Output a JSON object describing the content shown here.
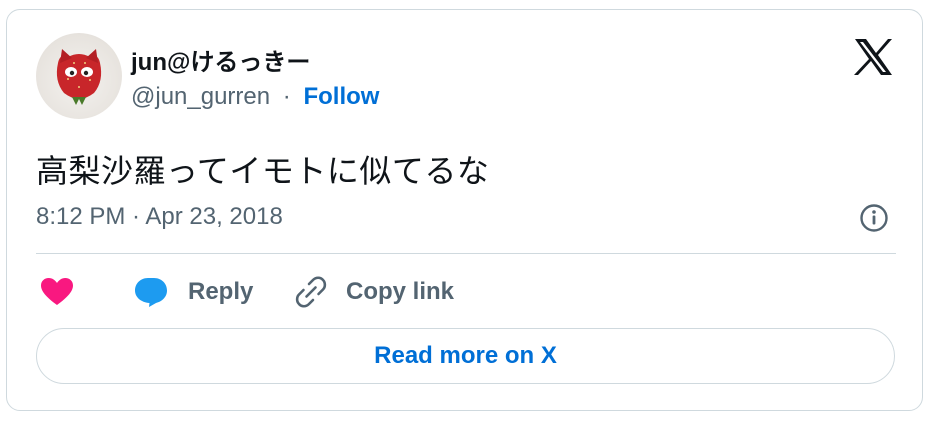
{
  "author": {
    "name": "jun@けるっきー",
    "handle": "@jun_gurren",
    "separator": "·",
    "follow_label": "Follow",
    "avatar_icon": "strawberry-cat-avatar-icon"
  },
  "tweet": {
    "text": "高梨沙羅ってイモトに似てるな",
    "timestamp": "8:12 PM · Apr 23, 2018"
  },
  "actions": {
    "like_icon": "heart-icon",
    "reply_icon": "speech-bubble-icon",
    "reply_label": "Reply",
    "copy_icon": "link-icon",
    "copy_label": "Copy link"
  },
  "read_more_label": "Read more on X",
  "icons": {
    "logo": "x-logo-icon",
    "info": "info-icon"
  },
  "colors": {
    "text_primary": "#0f1419",
    "text_secondary": "#536471",
    "link_blue": "#006fd6",
    "like_pink": "#f91880",
    "reply_blue": "#1d9bf0",
    "border": "#cfd9de"
  }
}
